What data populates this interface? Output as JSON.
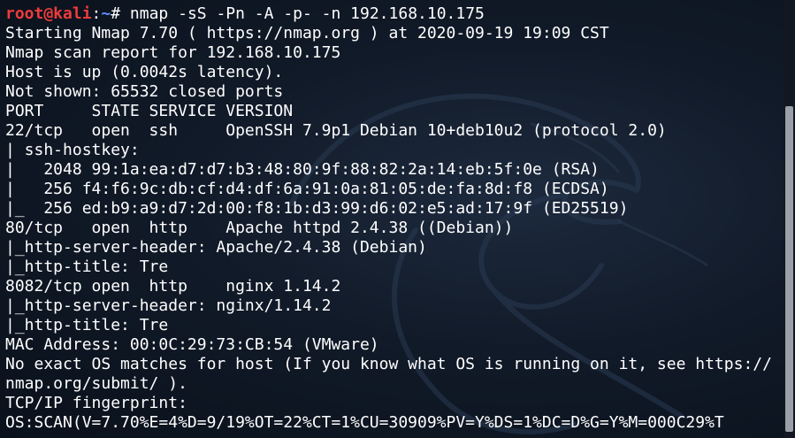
{
  "prompt": {
    "user": "root@kali",
    "sep": ":",
    "path": "~",
    "symbol": "# ",
    "command": "nmap -sS -Pn -A -p- -n 192.168.10.175"
  },
  "lines": [
    "Starting Nmap 7.70 ( https://nmap.org ) at 2020-09-19 19:09 CST",
    "Nmap scan report for 192.168.10.175",
    "Host is up (0.0042s latency).",
    "Not shown: 65532 closed ports",
    "PORT     STATE SERVICE VERSION",
    "22/tcp   open  ssh     OpenSSH 7.9p1 Debian 10+deb10u2 (protocol 2.0)",
    "| ssh-hostkey:",
    "|   2048 99:1a:ea:d7:d7:b3:48:80:9f:88:82:2a:14:eb:5f:0e (RSA)",
    "|   256 f4:f6:9c:db:cf:d4:df:6a:91:0a:81:05:de:fa:8d:f8 (ECDSA)",
    "|_  256 ed:b9:a9:d7:2d:00:f8:1b:d3:99:d6:02:e5:ad:17:9f (ED25519)",
    "80/tcp   open  http    Apache httpd 2.4.38 ((Debian))",
    "|_http-server-header: Apache/2.4.38 (Debian)",
    "|_http-title: Tre",
    "8082/tcp open  http    nginx 1.14.2",
    "|_http-server-header: nginx/1.14.2",
    "|_http-title: Tre",
    "MAC Address: 00:0C:29:73:CB:54 (VMware)",
    "No exact OS matches for host (If you know what OS is running on it, see https://",
    "nmap.org/submit/ ).",
    "TCP/IP fingerprint:",
    "OS:SCAN(V=7.70%E=4%D=9/19%OT=22%CT=1%CU=30909%PV=Y%DS=1%DC=D%G=Y%M=000C29%T"
  ],
  "colors": {
    "prompt_user": "#ef3b3b",
    "prompt_path": "#5c8cff",
    "text": "#ffffff",
    "background": "#111a28"
  }
}
